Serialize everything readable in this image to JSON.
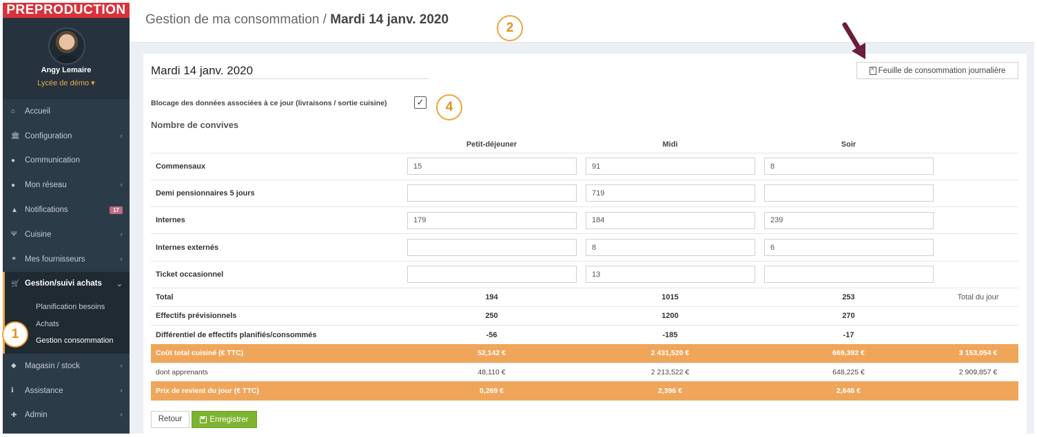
{
  "sidebar": {
    "env_label": "PREPRODUCTION",
    "user_name": "Angy Lemaire",
    "school": "Lycée de démo ▾",
    "menu": [
      {
        "label": "Accueil",
        "icon": "home-icon",
        "glyph": "⌂",
        "chevron": ""
      },
      {
        "label": "Configuration",
        "icon": "bank-icon",
        "glyph": "🏛",
        "chevron": "‹"
      },
      {
        "label": "Communication",
        "icon": "chat-icon",
        "glyph": "●",
        "chevron": ""
      },
      {
        "label": "Mon réseau",
        "icon": "users-icon",
        "glyph": "●",
        "chevron": "‹"
      },
      {
        "label": "Notifications",
        "icon": "bell-icon",
        "glyph": "▲",
        "chevron": "",
        "badge": "17"
      },
      {
        "label": "Cuisine",
        "icon": "cutlery-icon",
        "glyph": "Ψ",
        "chevron": "‹"
      },
      {
        "label": "Mes fournisseurs",
        "icon": "handshake-icon",
        "glyph": "⚭",
        "chevron": "‹"
      }
    ],
    "active_menu": {
      "label": "Gestion/suivi achats",
      "icon": "cart-icon",
      "glyph": "🛒",
      "chevron": "⌄"
    },
    "submenu": [
      "Planification besoins",
      "Achats",
      "Gestion consommation"
    ],
    "menu_after": [
      {
        "label": "Magasin / stock",
        "icon": "cubes-icon",
        "glyph": "◆",
        "chevron": "‹"
      },
      {
        "label": "Assistance",
        "icon": "info-icon",
        "glyph": "ℹ",
        "chevron": "‹"
      },
      {
        "label": "Admin",
        "icon": "user-plus-icon",
        "glyph": "✚",
        "chevron": "‹"
      }
    ]
  },
  "header": {
    "title_prefix": "Gestion de ma consommation / ",
    "title_date": "Mardi 14 janv. 2020"
  },
  "annotations": {
    "one": "1",
    "two": "2",
    "four": "4"
  },
  "panel": {
    "date_title": "Mardi 14 janv. 2020",
    "sheet_button": "Feuille de consommation journalière",
    "block_label": "Blocage des données associées à ce jour (livraisons / sortie cuisine)",
    "block_checked": "✓",
    "section_title": "Nombre de convives"
  },
  "table": {
    "headers": [
      "Petit-déjeuner",
      "Midi",
      "Soir"
    ],
    "input_rows": [
      {
        "label": "Commensaux",
        "values": [
          "15",
          "91",
          "8"
        ]
      },
      {
        "label": "Demi pensionnaires 5 jours",
        "values": [
          "",
          "719",
          ""
        ]
      },
      {
        "label": "Internes",
        "values": [
          "179",
          "184",
          "239"
        ]
      },
      {
        "label": "Internes externés",
        "values": [
          "",
          "8",
          "6"
        ]
      },
      {
        "label": "Ticket occasionnel",
        "values": [
          "",
          "13",
          ""
        ]
      }
    ],
    "total": {
      "label": "Total",
      "values": [
        "194",
        "1015",
        "253"
      ],
      "extra": "Total du jour"
    },
    "previsionnels": {
      "label": "Effectifs prévisionnels",
      "values": [
        "250",
        "1200",
        "270"
      ]
    },
    "differentiel": {
      "label": "Différentiel de effectifs planifiés/consommés",
      "values": [
        "-56",
        "-185",
        "-17"
      ]
    },
    "cout_total": {
      "label": "Coût total cuisiné (€ TTC)",
      "values": [
        "52,142 €",
        "2 431,520 €",
        "669,392 €"
      ],
      "extra": "3 153,054 €"
    },
    "apprenants": {
      "label": "dont apprenants",
      "values": [
        "48,110 €",
        "2 213,522 €",
        "648,225 €"
      ],
      "extra": "2 909,857 €"
    },
    "prix_revient": {
      "label": "Prix de revient du jour (€ TTC)",
      "values": [
        "0,269 €",
        "2,396 €",
        "2,646 €"
      ],
      "extra": ""
    }
  },
  "buttons": {
    "back": "Retour",
    "save": "Enregistrer"
  },
  "colors": {
    "accent_orange": "#f0a65a",
    "save_green": "#7db330",
    "preprod_red": "#d9323a",
    "sidebar_bg": "#2c3b48",
    "arrow": "#6b1d3c"
  }
}
